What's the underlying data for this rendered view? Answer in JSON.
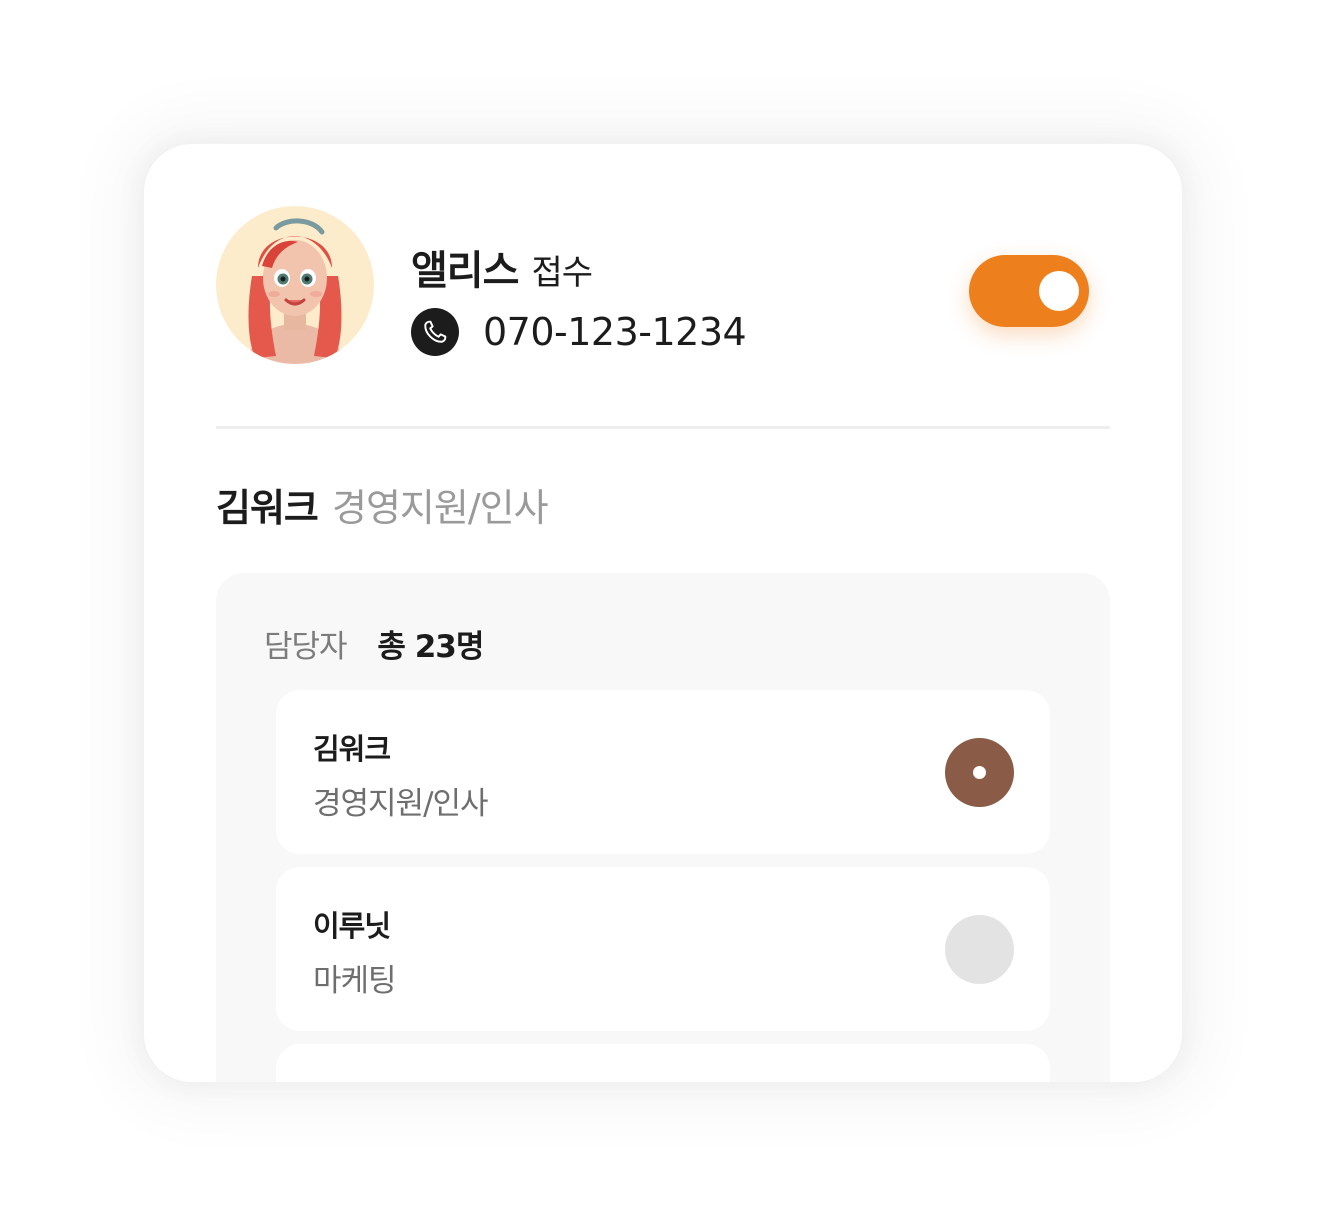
{
  "header": {
    "name": "앨리스",
    "status": "접수",
    "phone": "070-123-1234",
    "toggle_on": true,
    "accent_color": "#ee7f1d"
  },
  "selected": {
    "name": "김워크",
    "department": "경영지원/인사"
  },
  "managers": {
    "label": "담당자",
    "total": "총 23명",
    "items": [
      {
        "name": "김워크",
        "department": "경영지원/인사",
        "selected": true
      },
      {
        "name": "이루닛",
        "department": "마케팅",
        "selected": false
      },
      {
        "name": "",
        "department": "",
        "selected": false
      }
    ]
  },
  "icons": {
    "phone": "phone-icon",
    "avatar": "avatar-image"
  }
}
